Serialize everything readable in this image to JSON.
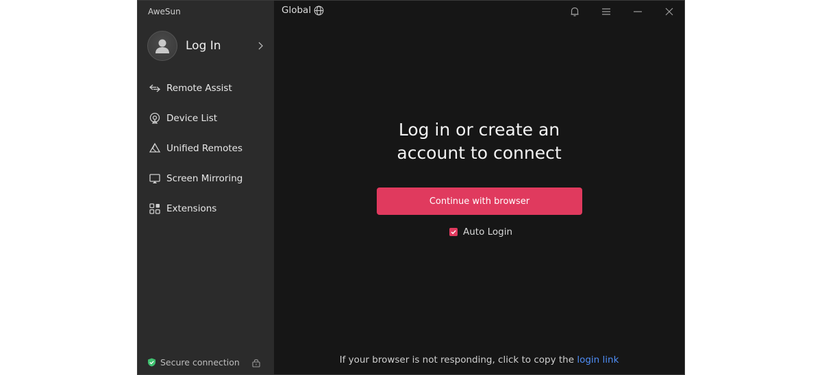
{
  "app": {
    "title": "AweSun"
  },
  "account": {
    "login_label": "Log In"
  },
  "sidebar": {
    "items": [
      {
        "label": "Remote Assist",
        "icon": "remote-assist-icon"
      },
      {
        "label": "Device List",
        "icon": "device-list-icon"
      },
      {
        "label": "Unified Remotes",
        "icon": "unified-remotes-icon"
      },
      {
        "label": "Screen Mirroring",
        "icon": "screen-mirroring-icon"
      },
      {
        "label": "Extensions",
        "icon": "extensions-icon"
      }
    ],
    "secure_label": "Secure connection"
  },
  "header": {
    "region_label": "Global"
  },
  "main": {
    "headline_line1": "Log in or create an",
    "headline_line2": "account to connect",
    "browser_button_label": "Continue with browser",
    "auto_login_label": "Auto Login",
    "auto_login_checked": true,
    "footer_text": "If your browser is not responding, click to copy the ",
    "footer_link": "login link"
  },
  "colors": {
    "accent": "#e03a5e",
    "link": "#4f8ef7",
    "secure": "#3fbf6f",
    "sidebar_bg": "#2b2b2b",
    "main_bg": "#161616"
  }
}
